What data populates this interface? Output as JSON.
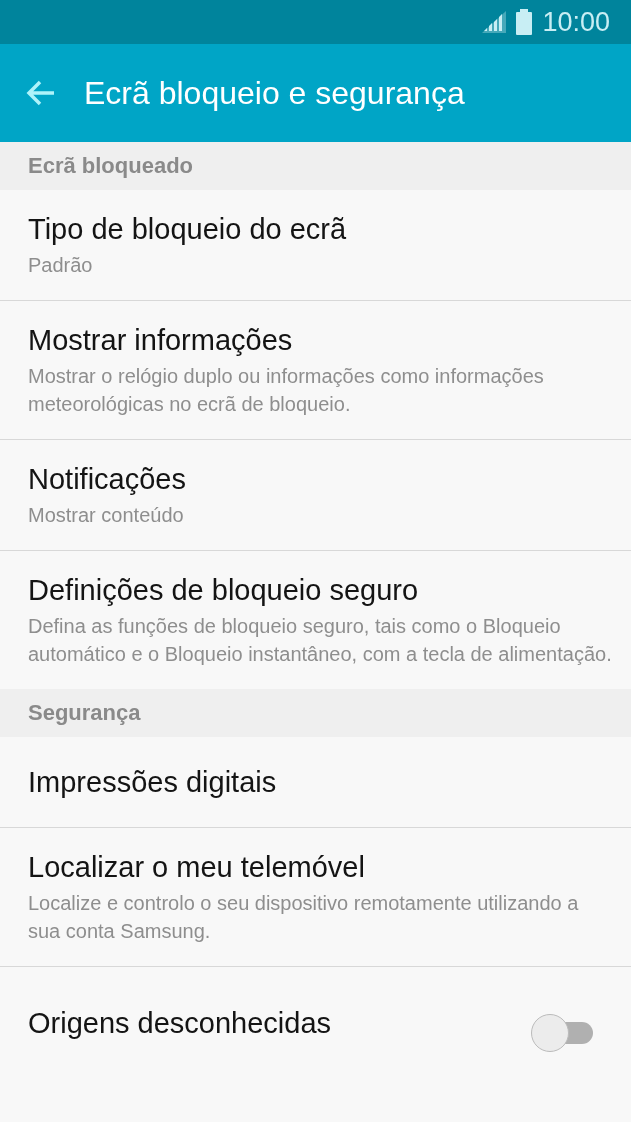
{
  "status_bar": {
    "time": "10:00"
  },
  "app_bar": {
    "title": "Ecrã bloqueio e segurança"
  },
  "sections": [
    {
      "header": "Ecrã bloqueado",
      "items": [
        {
          "kind": "text",
          "title": "Tipo de bloqueio do ecrã",
          "subtitle": "Padrão"
        },
        {
          "kind": "text",
          "title": "Mostrar informações",
          "subtitle": "Mostrar o relógio duplo ou informações como informações meteorológicas no ecrã de bloqueio."
        },
        {
          "kind": "text",
          "title": "Notificações",
          "subtitle": "Mostrar conteúdo"
        },
        {
          "kind": "text",
          "title": "Definições de bloqueio seguro",
          "subtitle": "Defina as funções de bloqueio seguro, tais como o Bloqueio automático e o Bloqueio instantâneo, com a tecla de alimentação."
        }
      ]
    },
    {
      "header": "Segurança",
      "items": [
        {
          "kind": "text",
          "title": "Impressões digitais"
        },
        {
          "kind": "text",
          "title": "Localizar o meu telemóvel",
          "subtitle": "Localize e controlo o seu dispositivo remotamente utilizando a sua conta Samsung."
        },
        {
          "kind": "switch",
          "title": "Origens desconhecidas",
          "on": false
        }
      ]
    }
  ]
}
